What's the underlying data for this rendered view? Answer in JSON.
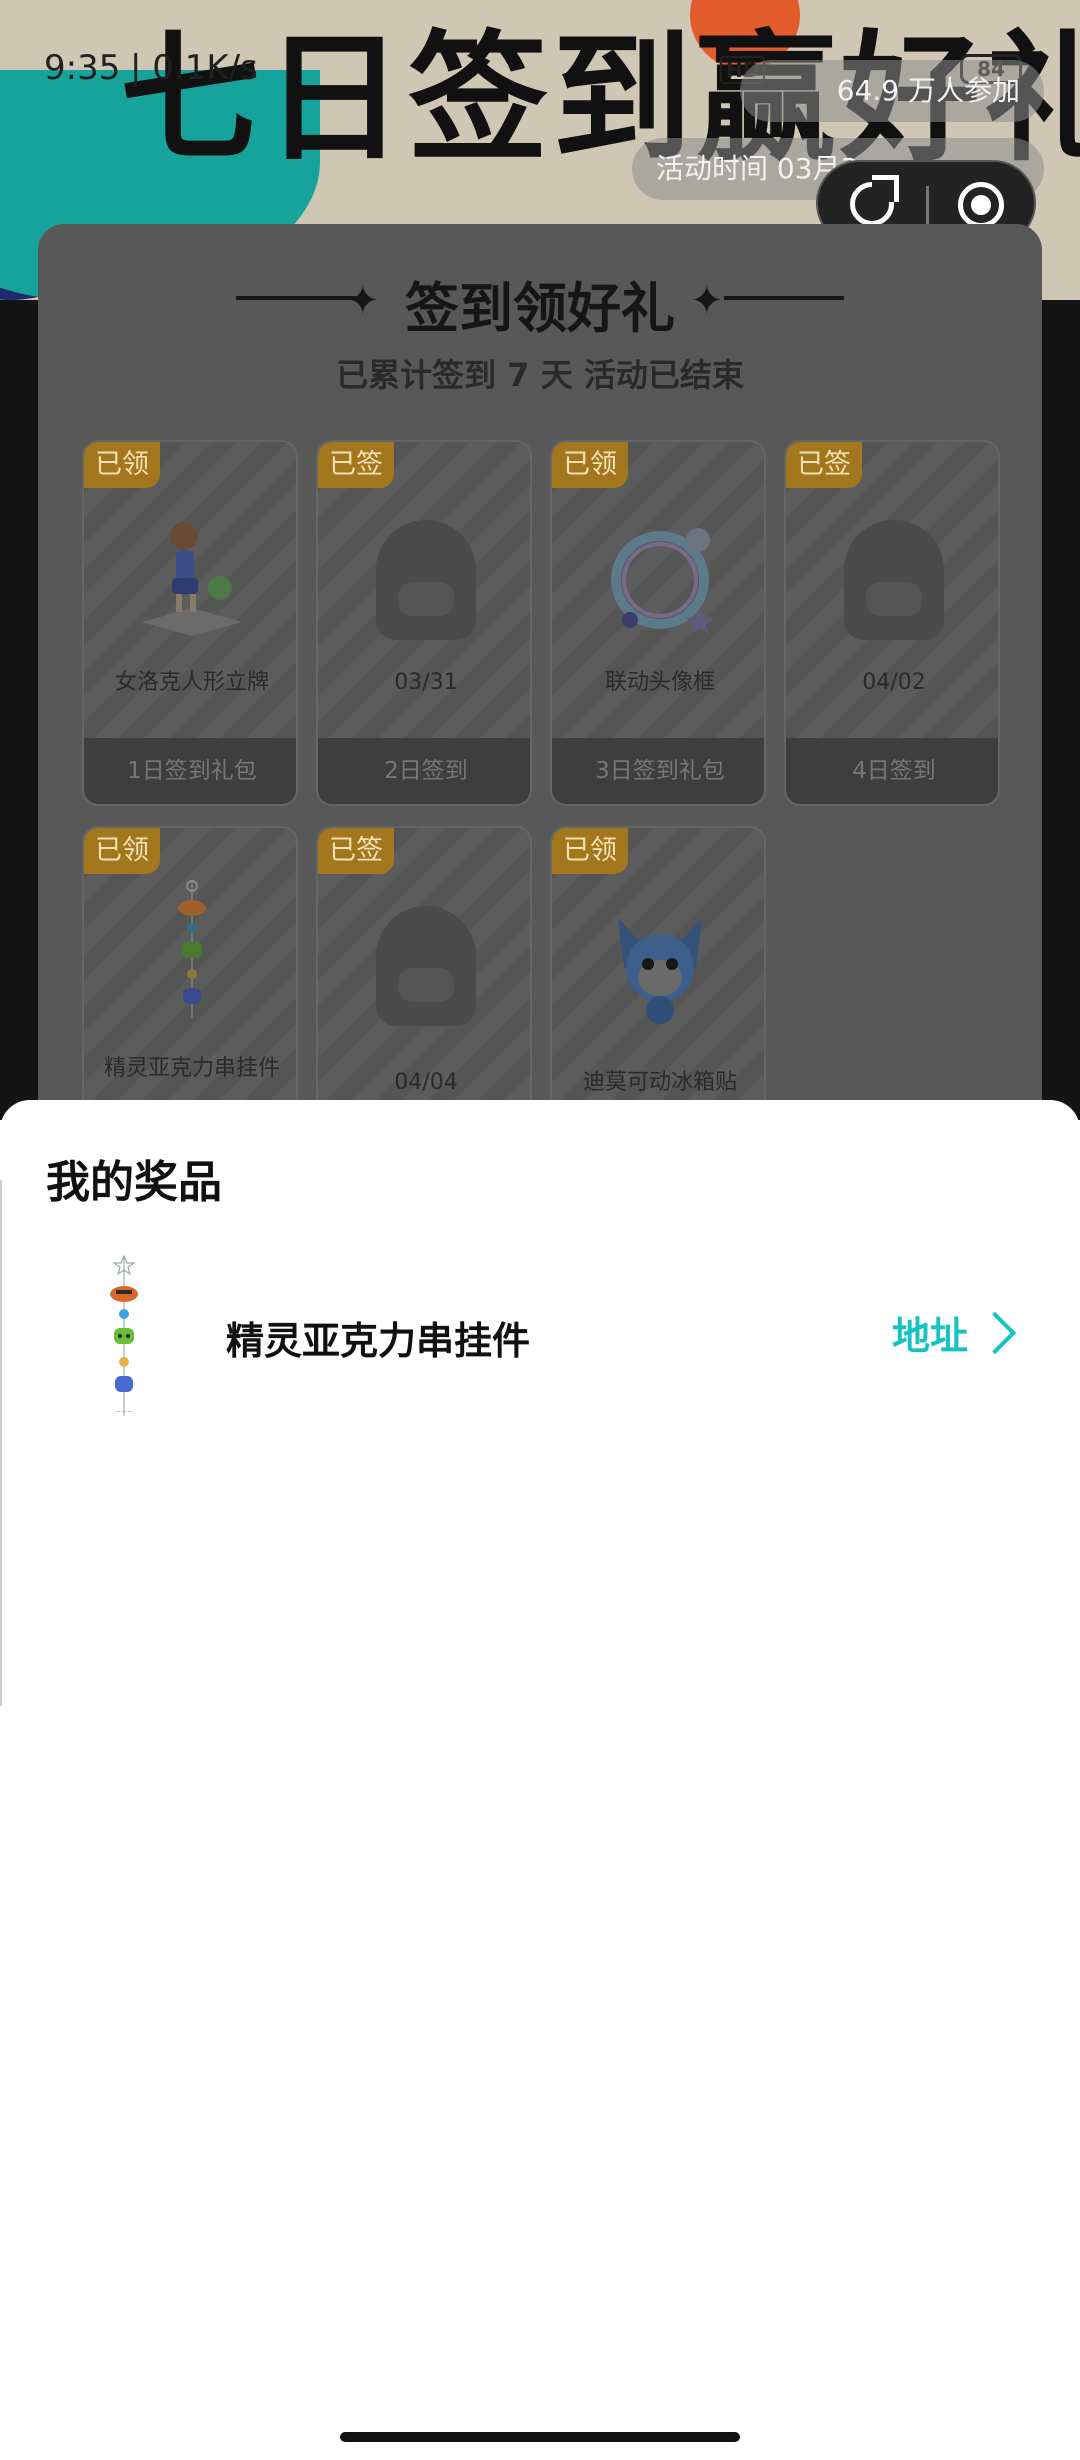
{
  "status_bar": {
    "time": "9:35",
    "network": "| 0.1K/s",
    "hd": "HD",
    "battery": "84"
  },
  "hero": {
    "title": "七日签到赢好礼",
    "participants": "64.9 万人参加",
    "activity_time": "活动时间 03月3"
  },
  "checkin": {
    "title": "签到领好礼",
    "summary": "已累计签到 7 天  活动已结束",
    "days": [
      {
        "badge": "已领",
        "name": "女洛克人形立牌",
        "footer": "1日签到礼包",
        "image": "figure-standee"
      },
      {
        "badge": "已签",
        "name": "03/31",
        "footer": "2日签到",
        "image": "placeholder"
      },
      {
        "badge": "已领",
        "name": "联动头像框",
        "footer": "3日签到礼包",
        "image": "avatar-frame"
      },
      {
        "badge": "已签",
        "name": "04/02",
        "footer": "4日签到",
        "image": "placeholder"
      },
      {
        "badge": "已领",
        "name": "精灵亚克力串挂件",
        "footer": "",
        "image": "acrylic-charm"
      },
      {
        "badge": "已签",
        "name": "04/04",
        "footer": "",
        "image": "placeholder"
      },
      {
        "badge": "已领",
        "name": "迪莫可动冰箱贴",
        "footer": "",
        "image": "fridge-magnet"
      }
    ]
  },
  "prizes_sheet": {
    "title": "我的奖品",
    "items": [
      {
        "name": "精灵亚克力串挂件",
        "action": "地址",
        "image": "acrylic-charm"
      }
    ]
  },
  "colors": {
    "accent": "#17c3c1",
    "badge": "#a3771d",
    "overlay_card": "#585858"
  }
}
